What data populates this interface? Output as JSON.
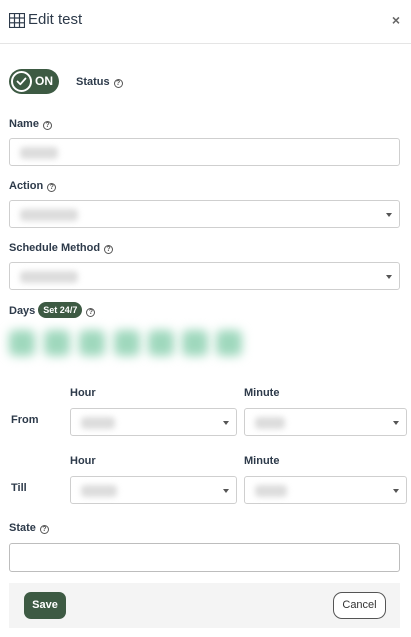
{
  "header": {
    "title": "Edit test",
    "icon": "table-icon",
    "close_label": "×"
  },
  "status": {
    "toggle_label": "ON",
    "label": "Status"
  },
  "name": {
    "label": "Name"
  },
  "action": {
    "label": "Action"
  },
  "schedule": {
    "label": "Schedule Method"
  },
  "days": {
    "label": "Days",
    "badge": "Set 24/7"
  },
  "from": {
    "label": "From",
    "hour_label": "Hour",
    "minute_label": "Minute"
  },
  "till": {
    "label": "Till",
    "hour_label": "Hour",
    "minute_label": "Minute"
  },
  "state": {
    "label": "State"
  },
  "footer": {
    "save_label": "Save",
    "cancel_label": "Cancel"
  },
  "colors": {
    "accent": "#3d5a43",
    "day_chip": "#9fd8bd"
  }
}
